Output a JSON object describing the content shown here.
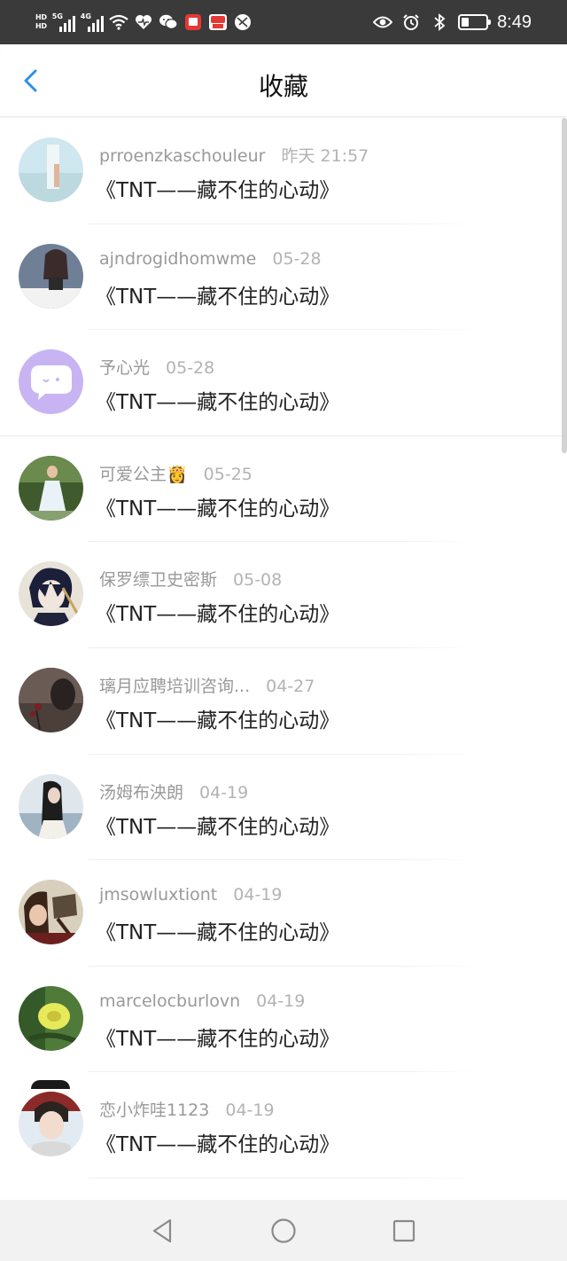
{
  "status_bar": {
    "hd1": "HD",
    "hd2": "HD",
    "net1": "5G",
    "net2": "4G",
    "time": "8:49",
    "battery_level": 0.28
  },
  "header": {
    "title": "收藏",
    "back_icon": "chevron-left-icon"
  },
  "favorites": [
    {
      "user": "prroenzkaschouleur",
      "date": "昨天 21:57",
      "title": "《TNT——藏不住的心动》",
      "avatar": "avatar-1"
    },
    {
      "user": "ajndrogidhomwme",
      "date": "05-28",
      "title": "《TNT——藏不住的心动》",
      "avatar": "avatar-2"
    },
    {
      "user": "予心光",
      "date": "05-28",
      "title": "《TNT——藏不住的心动》",
      "avatar": "avatar-3"
    },
    {
      "user": "可爱公主👸",
      "date": "05-25",
      "title": "《TNT——藏不住的心动》",
      "avatar": "avatar-4"
    },
    {
      "user": "保罗缥卫史密斯",
      "date": "05-08",
      "title": "《TNT——藏不住的心动》",
      "avatar": "avatar-5"
    },
    {
      "user": "璃月应聘培训咨询...",
      "date": "04-27",
      "title": "《TNT——藏不住的心动》",
      "avatar": "avatar-6"
    },
    {
      "user": "汤姆布泱朗",
      "date": "04-19",
      "title": "《TNT——藏不住的心动》",
      "avatar": "avatar-7"
    },
    {
      "user": "jmsowluxtiont",
      "date": "04-19",
      "title": "《TNT——藏不住的心动》",
      "avatar": "avatar-8"
    },
    {
      "user": "marcelocburlovn",
      "date": "04-19",
      "title": "《TNT——藏不住的心动》",
      "avatar": "avatar-9"
    },
    {
      "user": "恋小炸哇1123",
      "date": "04-19",
      "title": "《TNT——藏不住的心动》",
      "avatar": "avatar-10"
    }
  ],
  "navbar": {
    "back": "triangle-back-icon",
    "home": "circle-home-icon",
    "recents": "square-recents-icon"
  },
  "colors": {
    "accent": "#1e88e5",
    "status_bar_bg": "#3a3a3a",
    "meta_text": "#999999",
    "title_text": "#222222",
    "nav_bg": "#f2f2f2"
  }
}
